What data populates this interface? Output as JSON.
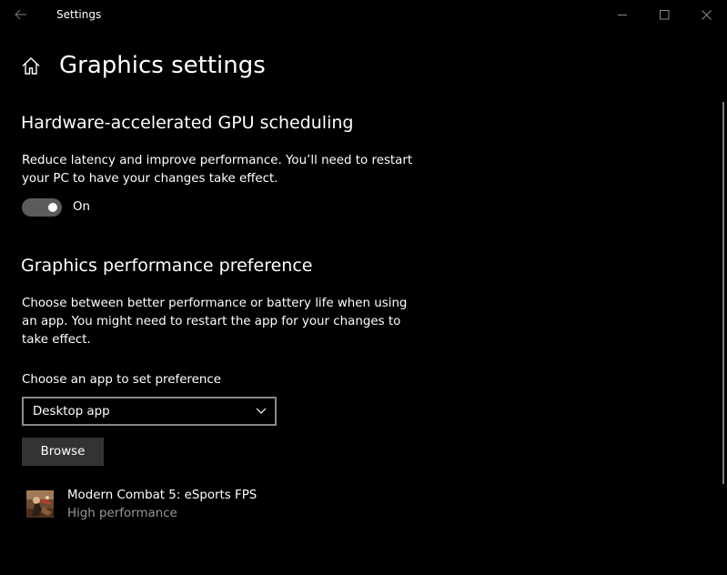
{
  "window": {
    "title": "Settings"
  },
  "header": {
    "title": "Graphics settings"
  },
  "gpu_scheduling": {
    "title": "Hardware-accelerated GPU scheduling",
    "description": "Reduce latency and improve performance. You’ll need to restart your PC to have your changes take effect.",
    "toggle_state": "On",
    "toggle_on": true
  },
  "performance_preference": {
    "title": "Graphics performance preference",
    "description": "Choose between better performance or battery life when using an app. You might need to restart the app for your changes to take effect.",
    "combo_label": "Choose an app to set preference",
    "combo_value": "Desktop app",
    "browse_label": "Browse",
    "apps": [
      {
        "name": "Modern Combat 5: eSports FPS",
        "preference": "High performance",
        "icon": "game-thumbnail-icon"
      }
    ]
  },
  "colors": {
    "background": "#000000",
    "text": "#ffffff",
    "secondary_text": "#999999",
    "toggle_track": "#5c5c5c",
    "button_bg": "#333333"
  }
}
